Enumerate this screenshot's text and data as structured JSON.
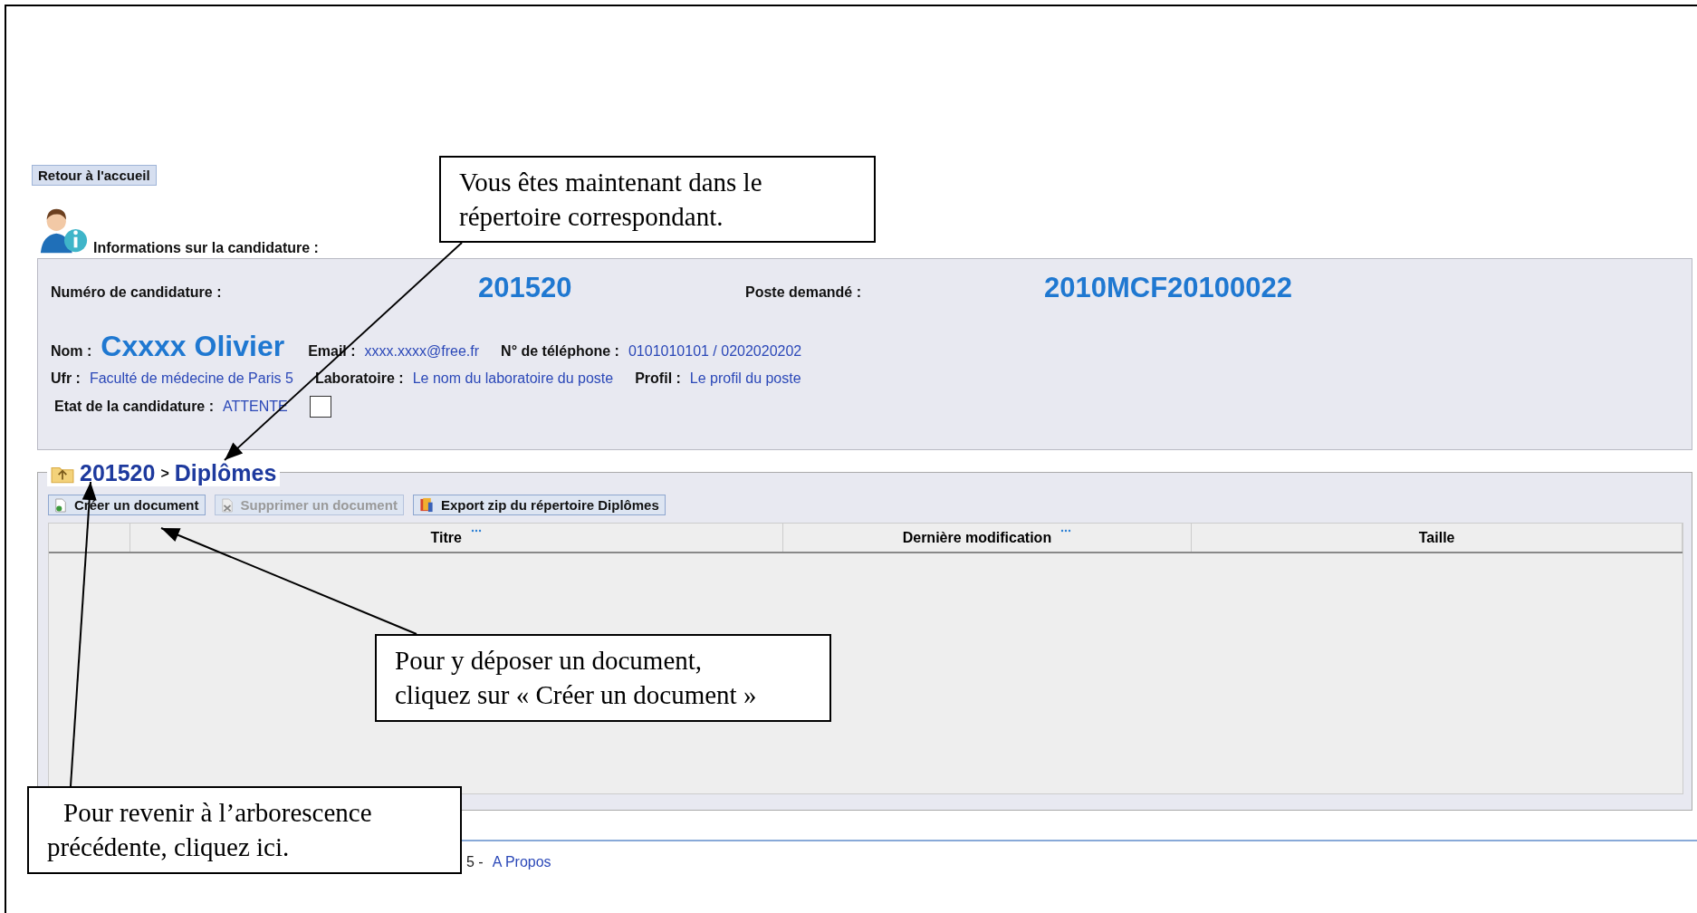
{
  "back_button": "Retour à l'accueil",
  "info": {
    "heading": "Informations sur la candidature :",
    "number_label": "Numéro de candidature :",
    "number": "201520",
    "post_label": "Poste demandé :",
    "post": "2010MCF20100022",
    "name_label": "Nom :",
    "name": "Cxxxx Olivier",
    "email_label": "Email :",
    "email": "xxxx.xxxx@free.fr",
    "phone_label": "N° de téléphone :",
    "phone": "0101010101  /  0202020202",
    "ufr_label": "Ufr :",
    "ufr": "Faculté de médecine de Paris 5",
    "lab_label": "Laboratoire :",
    "lab": "Le nom du laboratoire du poste",
    "profile_label": "Profil :",
    "profile": "Le profil du poste",
    "state_label": "Etat de la candidature :",
    "state": "ATTENTE",
    "checked": false
  },
  "folder": {
    "breadcrumb": [
      {
        "label": "201520"
      },
      {
        "label": "Diplômes"
      }
    ],
    "separator": ">",
    "toolbar": [
      {
        "label": "Créer un document",
        "kind": "create",
        "disabled": false
      },
      {
        "label": "Supprimer un document",
        "kind": "delete",
        "disabled": true
      },
      {
        "label": "Export zip du répertoire Diplômes",
        "kind": "export",
        "disabled": false
      }
    ],
    "columns": [
      {
        "sortable": false
      },
      {
        "label": "Titre",
        "sortable": true
      },
      {
        "label": "Dernière modification",
        "sortable": true
      },
      {
        "label": "Taille",
        "sortable": false
      }
    ]
  },
  "footer": {
    "fragment": "5  -",
    "link": "A Propos"
  },
  "callouts": [
    {
      "text": "Vous êtes maintenant dans le répertoire correspondant."
    },
    {
      "text": "Pour y déposer un document, cliquez sur « Créer un document »"
    },
    {
      "text": "Pour revenir à l’arborescence précédente, cliquez ici."
    }
  ]
}
